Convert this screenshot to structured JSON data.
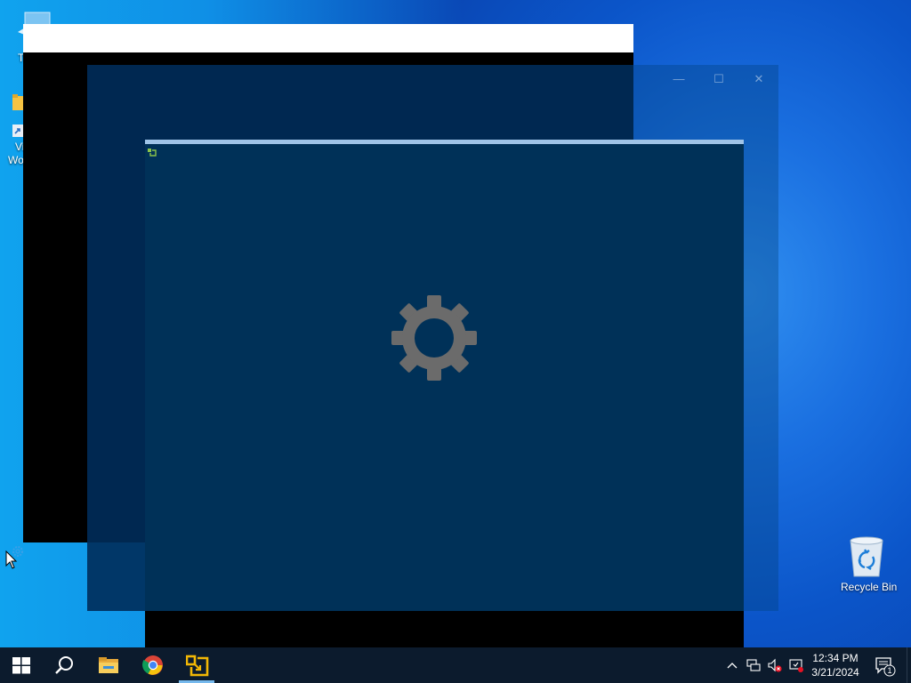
{
  "desktop": {
    "icons": [
      {
        "label": "T"
      },
      {
        "label": "Vi"
      },
      {
        "label": "Wo"
      },
      {
        "label": "Recycle Bin"
      }
    ]
  },
  "windows": {
    "blue_window": {
      "minimize_glyph": "—",
      "maximize_glyph": "☐",
      "close_glyph": "✕"
    },
    "front_window": {
      "loading_icon": "gear-icon"
    }
  },
  "taskbar": {
    "buttons": [
      "start-icon",
      "search-icon",
      "file-explorer-icon",
      "chrome-icon",
      "app-icon"
    ],
    "clock": {
      "time": "12:34 PM",
      "date": "3/21/2024"
    },
    "notification_count": "1",
    "tray_icons": [
      "chevron-up-icon",
      "network-icon",
      "volume-muted-icon",
      "security-icon"
    ]
  },
  "colors": {
    "taskbar": "#0c1b2d",
    "window_content": "#003158",
    "accent": "#76b9ed"
  }
}
